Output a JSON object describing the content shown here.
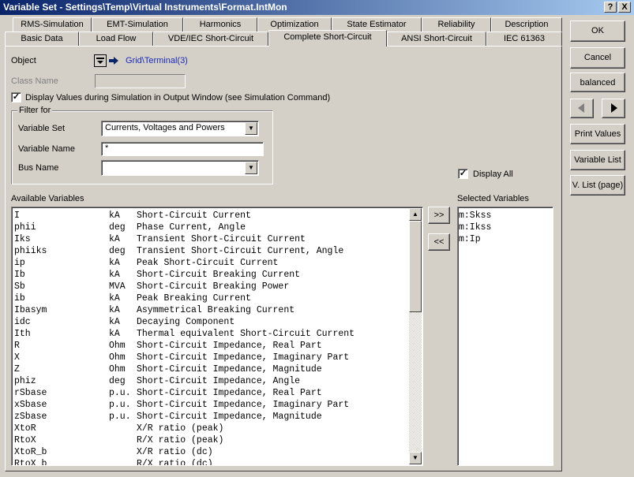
{
  "title": "Variable Set - Settings\\Temp\\Virtual Instruments\\Format.IntMon",
  "title_buttons": {
    "help": "?",
    "close": "X"
  },
  "tabs_row1": [
    "RMS-Simulation",
    "EMT-Simulation",
    "Harmonics",
    "Optimization",
    "State Estimator",
    "Reliability",
    "Description"
  ],
  "tabs_row2": [
    "Basic Data",
    "Load Flow",
    "VDE/IEC Short-Circuit",
    "Complete Short-Circuit",
    "ANSI Short-Circuit",
    "IEC 61363"
  ],
  "active_tab": "Complete Short-Circuit",
  "object": {
    "label": "Object",
    "link": "Grid\\Terminal(3)"
  },
  "class_name": {
    "label": "Class Name",
    "value": ""
  },
  "display_values": {
    "label": "Display Values during Simulation in Output Window (see Simulation Command)",
    "checked": true
  },
  "filter": {
    "legend": "Filter for",
    "variable_set_label": "Variable Set",
    "variable_set_value": "Currents, Voltages and Powers",
    "variable_name_label": "Variable Name",
    "variable_name_value": "*",
    "bus_name_label": "Bus Name",
    "bus_name_value": ""
  },
  "display_all": {
    "label": "Display All",
    "checked": true
  },
  "available": {
    "label": "Available Variables",
    "rows": [
      [
        "I",
        "kA",
        "Short-Circuit Current"
      ],
      [
        "phii",
        "deg",
        "Phase Current, Angle"
      ],
      [
        "Iks",
        "kA",
        "Transient Short-Circuit Current"
      ],
      [
        "phiiks",
        "deg",
        "Transient Short-Circuit Current, Angle"
      ],
      [
        "ip",
        "kA",
        "Peak Short-Circuit Current"
      ],
      [
        "Ib",
        "kA",
        "Short-Circuit Breaking Current"
      ],
      [
        "Sb",
        "MVA",
        "Short-Circuit Breaking Power"
      ],
      [
        "ib",
        "kA",
        "Peak Breaking Current"
      ],
      [
        "Ibasym",
        "kA",
        "Asymmetrical Breaking Current"
      ],
      [
        "idc",
        "kA",
        "Decaying Component"
      ],
      [
        "Ith",
        "kA",
        "Thermal equivalent Short-Circuit Current"
      ],
      [
        "R",
        "Ohm",
        "Short-Circuit Impedance, Real Part"
      ],
      [
        "X",
        "Ohm",
        "Short-Circuit Impedance, Imaginary Part"
      ],
      [
        "Z",
        "Ohm",
        "Short-Circuit Impedance, Magnitude"
      ],
      [
        "phiz",
        "deg",
        "Short-Circuit Impedance, Angle"
      ],
      [
        "rSbase",
        "p.u.",
        "Short-Circuit Impedance, Real Part"
      ],
      [
        "xSbase",
        "p.u.",
        "Short-Circuit Impedance, Imaginary Part"
      ],
      [
        "zSbase",
        "p.u.",
        "Short-Circuit Impedance, Magnitude"
      ],
      [
        "XtoR",
        "",
        "X/R ratio (peak)"
      ],
      [
        "RtoX",
        "",
        "R/X ratio (peak)"
      ],
      [
        "XtoR_b",
        "",
        "X/R ratio (dc)"
      ],
      [
        "RtoX_b",
        "",
        "R/X ratio (dc)"
      ]
    ]
  },
  "move_buttons": {
    "add": ">>",
    "remove": "<<"
  },
  "selected": {
    "label": "Selected Variables",
    "rows": [
      "m:Skss",
      "m:Ikss",
      "m:Ip"
    ]
  },
  "side_buttons": {
    "ok": "OK",
    "cancel": "Cancel",
    "balanced": "balanced",
    "print_values": "Print Values",
    "variable_list": "Variable List",
    "v_list_page": "V. List (page)"
  }
}
